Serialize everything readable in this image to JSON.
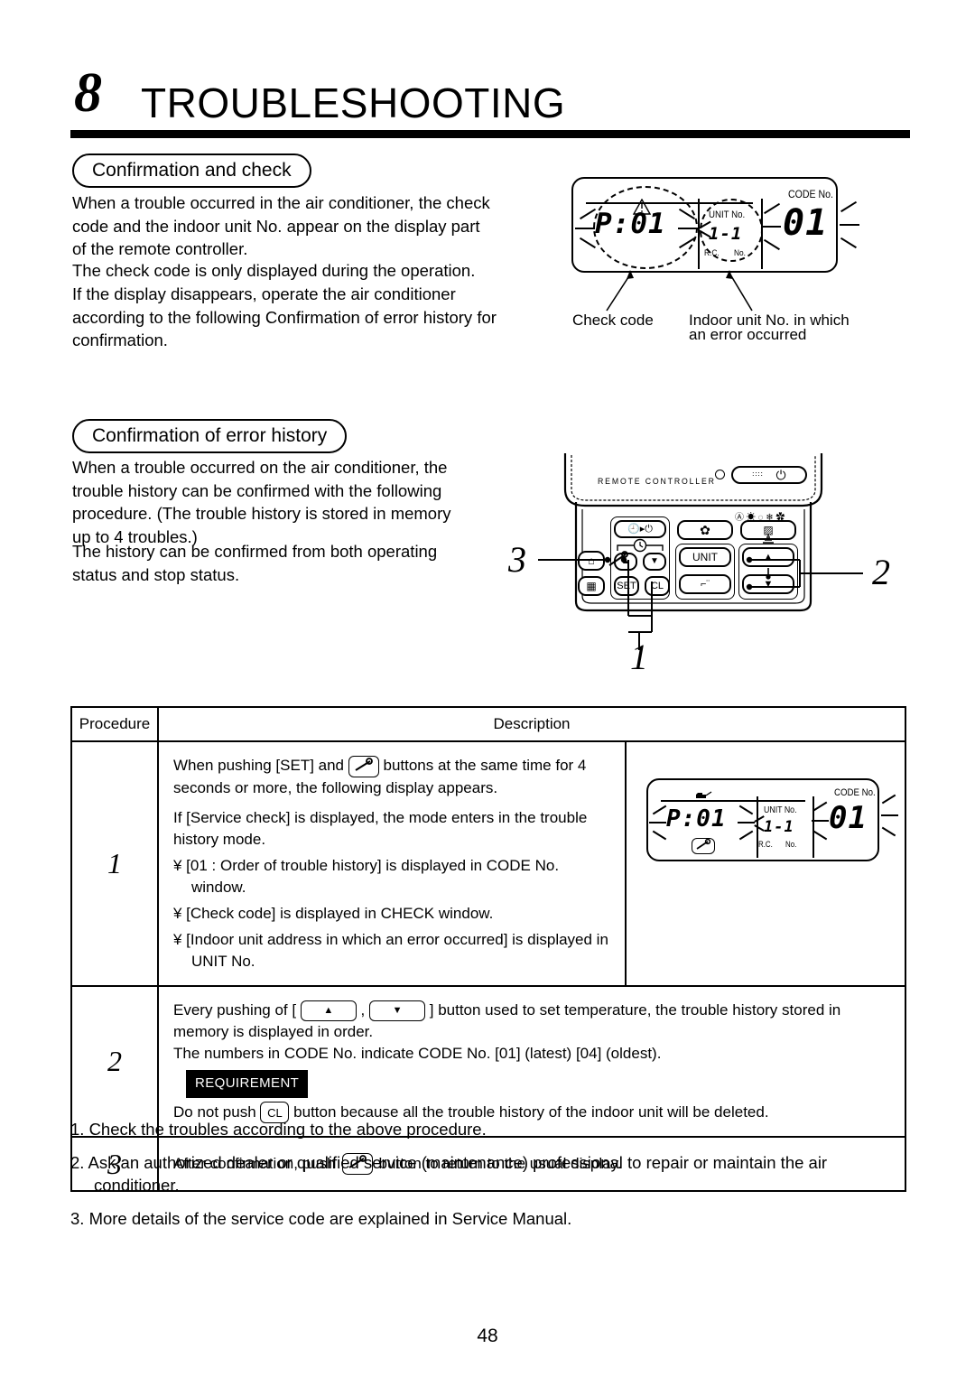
{
  "chapter": {
    "number": "8",
    "title": "TROUBLESHOOTING"
  },
  "section1": {
    "heading": "Confirmation and check",
    "paragraphs": [
      "When a trouble occurred in the air conditioner, the check code and the indoor unit No. appear on the display part of the remote controller.",
      "The check code is only displayed during the operation.",
      "If the display disappears, operate the air conditioner according to the following  Confirmation of error history  for confirmation."
    ],
    "lcd": {
      "check_code": "P:01",
      "unit_no_label": "UNIT No.",
      "rc_label": "R.C.",
      "no_label": "No.",
      "unit_value": "1-1",
      "code_no_label": "CODE No.",
      "code_value": "01"
    },
    "callouts": {
      "check_code": "Check code",
      "indoor_unit": "Indoor unit No. in which\nan error occurred",
      "indoor_unit_l1": "Indoor unit No. in which",
      "indoor_unit_l2": "an error occurred"
    }
  },
  "section2": {
    "heading": "Confirmation of error history",
    "paragraphs": [
      "When a trouble occurred on the air conditioner, the trouble history can be confirmed with the following procedure. (The trouble history is stored in memory up to 4 troubles.)",
      "The history can be confirmed from both operating status and stop status."
    ],
    "remote": {
      "brand_label": "REMOTE CONTROLLER",
      "unit_button": "UNIT",
      "set_button": "SET",
      "cl_button": "CL",
      "mode_icons": "Ⓐ ☀ ◌ ❄ ✿",
      "callout_1": "1",
      "callout_2": "2",
      "callout_3": "3"
    }
  },
  "table": {
    "headers": {
      "procedure": "Procedure",
      "description": "Description"
    },
    "rows": [
      {
        "num": "1",
        "lines": [
          "When pushing [SET] and  ⟨wrench⟩  buttons at the same time for 4 seconds or more, the following display appears.",
          "If [Service check] is displayed, the mode enters in the trouble history mode."
        ],
        "line1_a": "When pushing [SET] and",
        "line1_b": "buttons at the same time for 4 seconds or more, the following display appears.",
        "line2": "If [Service check] is displayed, the mode enters in the trouble history mode.",
        "bullets": [
          "¥ [01 : Order of trouble history] is displayed in CODE No. window.",
          "¥ [Check code] is displayed in CHECK window.",
          "¥ [Indoor unit address in which an error occurred] is displayed in UNIT No."
        ],
        "lcd": {
          "check_code": "P:01",
          "unit_no_label": "UNIT No.",
          "rc_label": "R.C.",
          "no_label": "No.",
          "unit_value": "1-1",
          "code_no_label": "CODE No.",
          "code_value": "01"
        }
      },
      {
        "num": "2",
        "line1_a": "Every pushing of [",
        "line1_b": ",",
        "line1_c": "] button used to set temperature, the trouble history stored in memory is displayed in order.",
        "line2": "The numbers in CODE No. indicate CODE No.  [01] (latest)     [04] (oldest).",
        "requirement_badge": "REQUIREMENT",
        "line3_a": "Do not push",
        "line3_b": "button because all the trouble history of the indoor unit will be deleted.",
        "up_arrow": "▲",
        "down_arrow": "▼",
        "cl_key": "CL"
      },
      {
        "num": "3",
        "line_a": "After confirmation, push",
        "line_b": "button to return to the usual display."
      }
    ]
  },
  "footer": {
    "items": [
      "1. Check the troubles according to the above procedure.",
      "2. Ask an authorized dealer or qualified service (maintenance) professional to repair or maintain the air conditioner.",
      "3. More details of the service code are explained in Service Manual."
    ]
  },
  "page_number": "48"
}
